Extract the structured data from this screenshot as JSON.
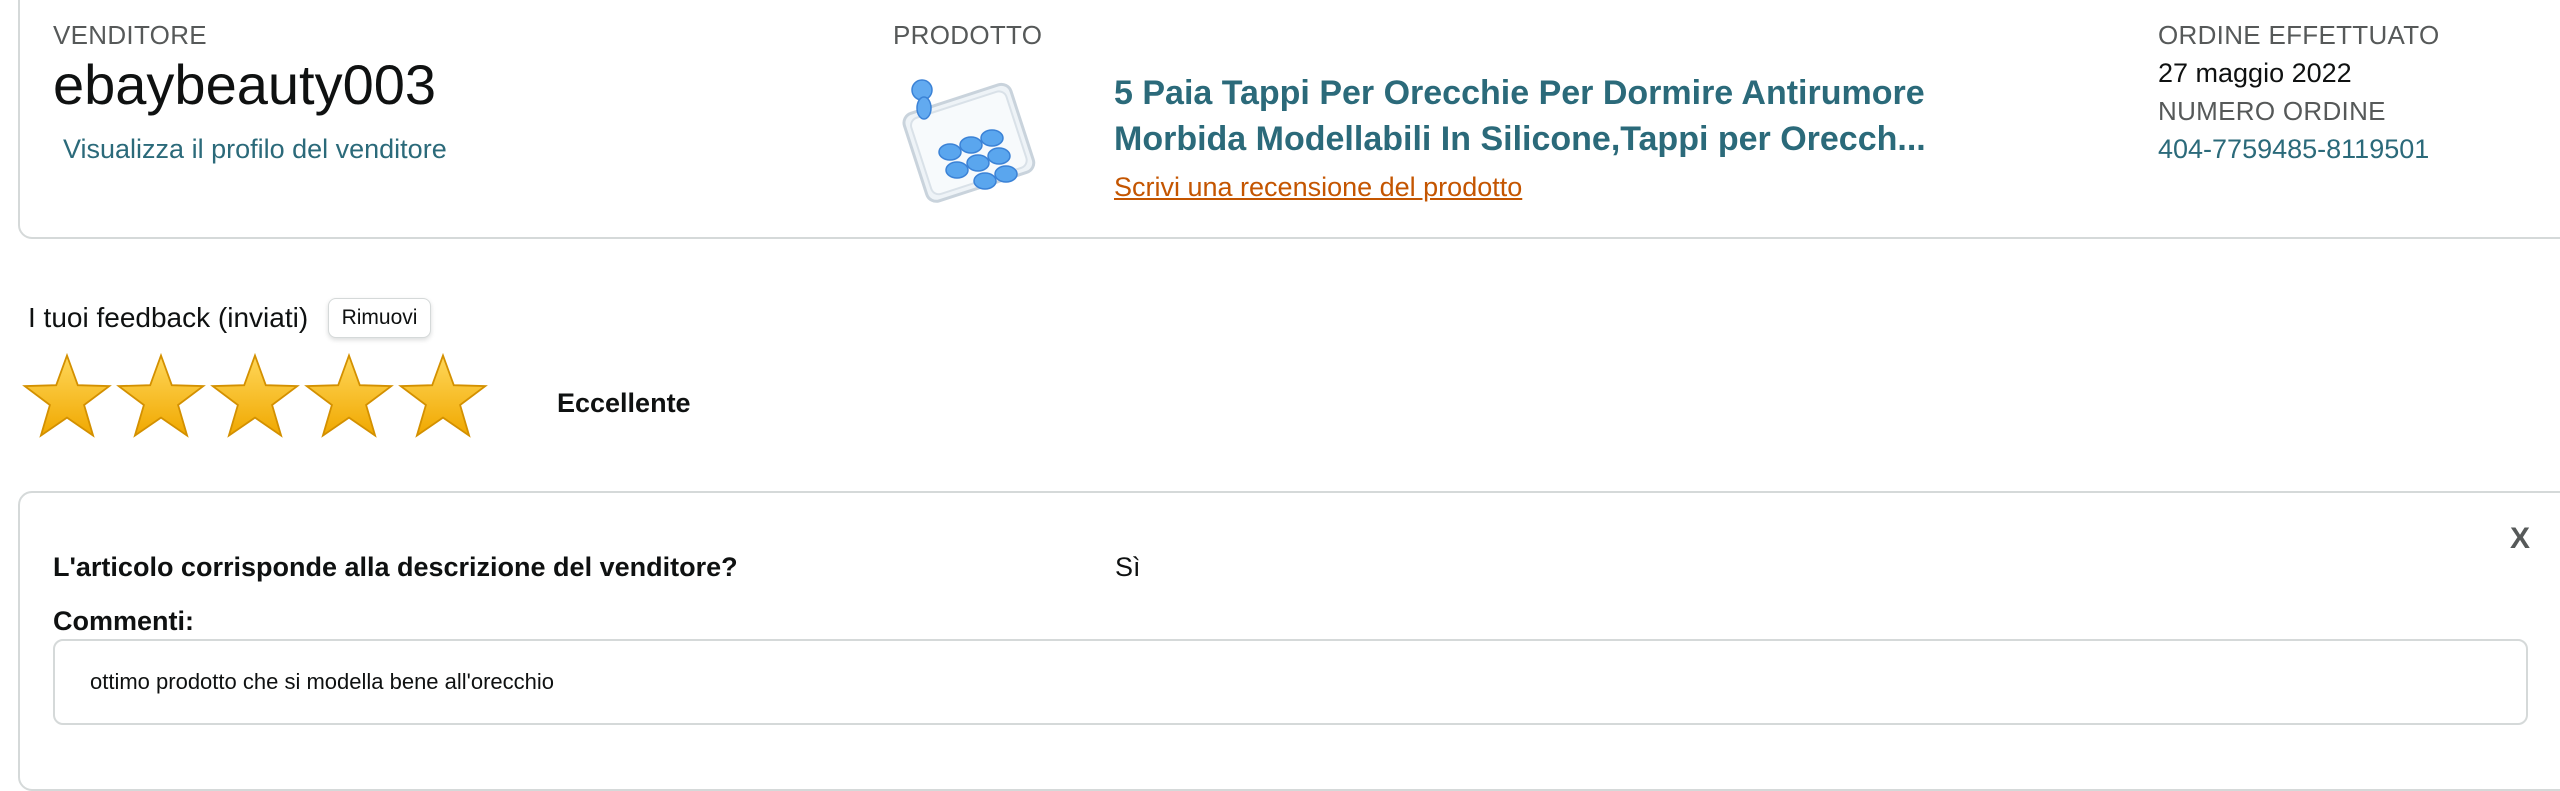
{
  "order": {
    "seller_label": "VENDITORE",
    "seller_name": "ebaybeauty003",
    "seller_profile_link": "Visualizza il profilo del venditore",
    "product_label": "PRODOTTO",
    "product_image_icon": "earplugs-product-image",
    "product_title": "5 Paia Tappi Per Orecchie Per Dormire Antirumore Morbida Modellabili In Silicone,Tappi per Orecch...",
    "review_link": "Scrivi una recensione del prodotto",
    "order_placed_label": "ORDINE EFFETTUATO",
    "order_date": "27 maggio 2022",
    "order_number_label": "NUMERO ORDINE",
    "order_number": "404-7759485-8119501"
  },
  "feedback": {
    "title": "I tuoi feedback (inviati)",
    "remove_button": "Rimuovi",
    "rating": 5,
    "rating_max": 5,
    "rating_text": "Eccellente",
    "star_icon": "star-icon"
  },
  "details": {
    "close_label": "X",
    "question": "L'articolo corrisponde alla descrizione del venditore?",
    "answer": "Sì",
    "comments_label": "Commenti:",
    "comment": "ottimo prodotto che si modella bene all'orecchio"
  },
  "colors": {
    "link": "#2b6a7a",
    "review_link": "#c45500",
    "star_fill": "#f4b400",
    "border": "#d5d9d9"
  }
}
